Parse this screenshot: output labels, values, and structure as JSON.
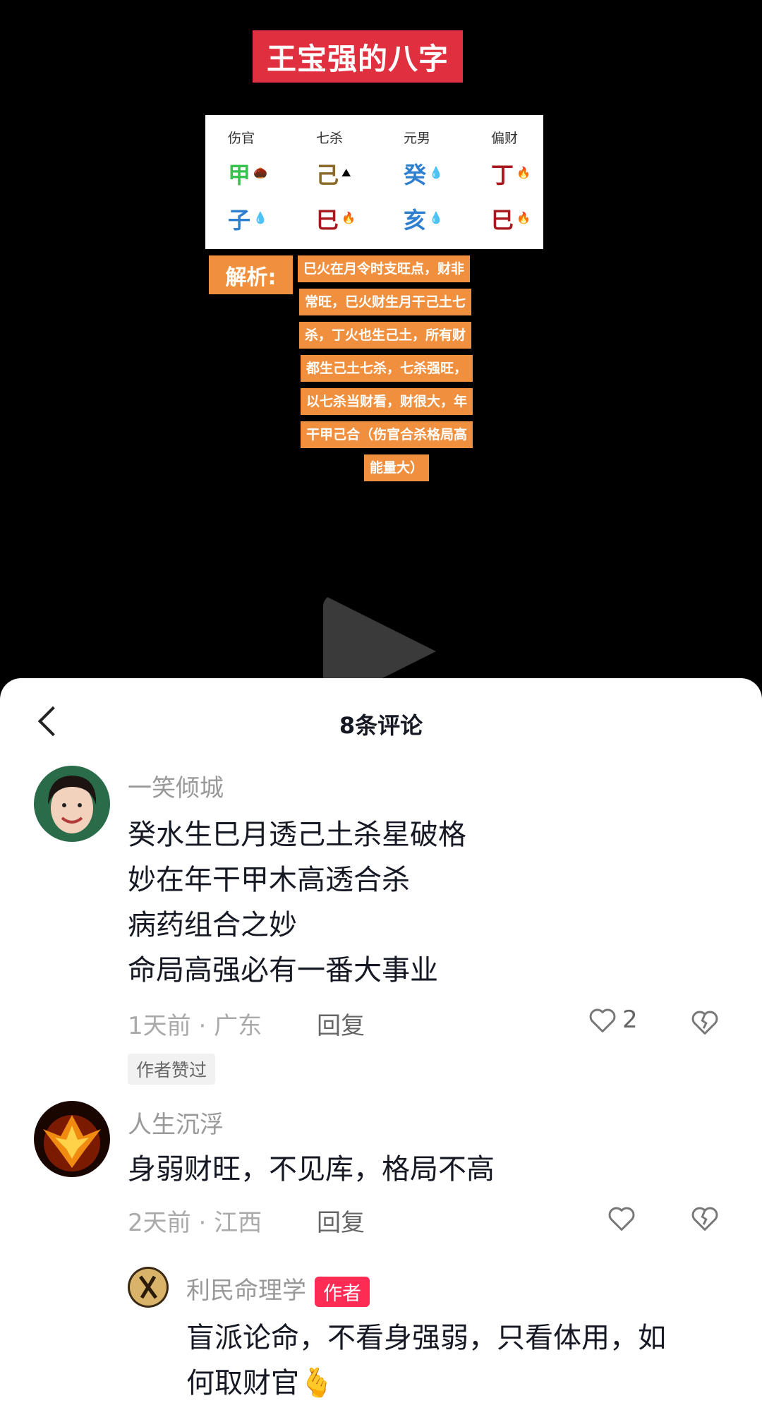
{
  "video": {
    "title": "王宝强的八字",
    "bazi": {
      "columns": [
        {
          "header": "伤官",
          "top": "甲",
          "top_color": "#39c24d",
          "top_emoji": "🌰",
          "bottom": "子",
          "bottom_color": "#2e7fd0",
          "bottom_emoji": "💧"
        },
        {
          "header": "七杀",
          "top": "己",
          "top_color": "#8a6a2a",
          "top_emoji": "⛰",
          "bottom": "巳",
          "bottom_color": "#a8181f",
          "bottom_emoji": "🔥"
        },
        {
          "header": "元男",
          "top": "癸",
          "top_color": "#2e7fd0",
          "top_emoji": "💧",
          "bottom": "亥",
          "bottom_color": "#2e7fd0",
          "bottom_emoji": "💧"
        },
        {
          "header": "偏财",
          "top": "丁",
          "top_color": "#a8181f",
          "top_emoji": "🔥",
          "bottom": "巳",
          "bottom_color": "#a8181f",
          "bottom_emoji": "🔥"
        }
      ]
    },
    "analysis_label": "解析:",
    "analysis_lines": [
      "巳火在月令时支旺点，财非",
      "常旺，巳火财生月干己土七",
      "杀，丁火也生己土，所有财",
      "都生己土七杀，七杀强旺，",
      "以七杀当财看，财很大，年",
      "干甲己合（伤官合杀格局高",
      "能量大）"
    ]
  },
  "sheet": {
    "title": "8条评论",
    "comments": [
      {
        "username": "一笑倾城",
        "lines": [
          "癸水生巳月透己土杀星破格",
          "妙在年干甲木高透合杀",
          "病药组合之妙",
          "命局高强必有一番大事业"
        ],
        "time": "1天前",
        "location": "广东",
        "reply": "回复",
        "likes": "2",
        "tag": "作者赞过"
      },
      {
        "username": "人生沉浮",
        "lines": [
          "身弱财旺，不见库，格局不高"
        ],
        "time": "2天前",
        "location": "江西",
        "reply": "回复"
      }
    ],
    "reply": {
      "username": "利民命理学",
      "badge": "作者",
      "lines": [
        "盲派论命，不看身强弱，只看体用，如",
        "何取财官🫰"
      ]
    }
  }
}
